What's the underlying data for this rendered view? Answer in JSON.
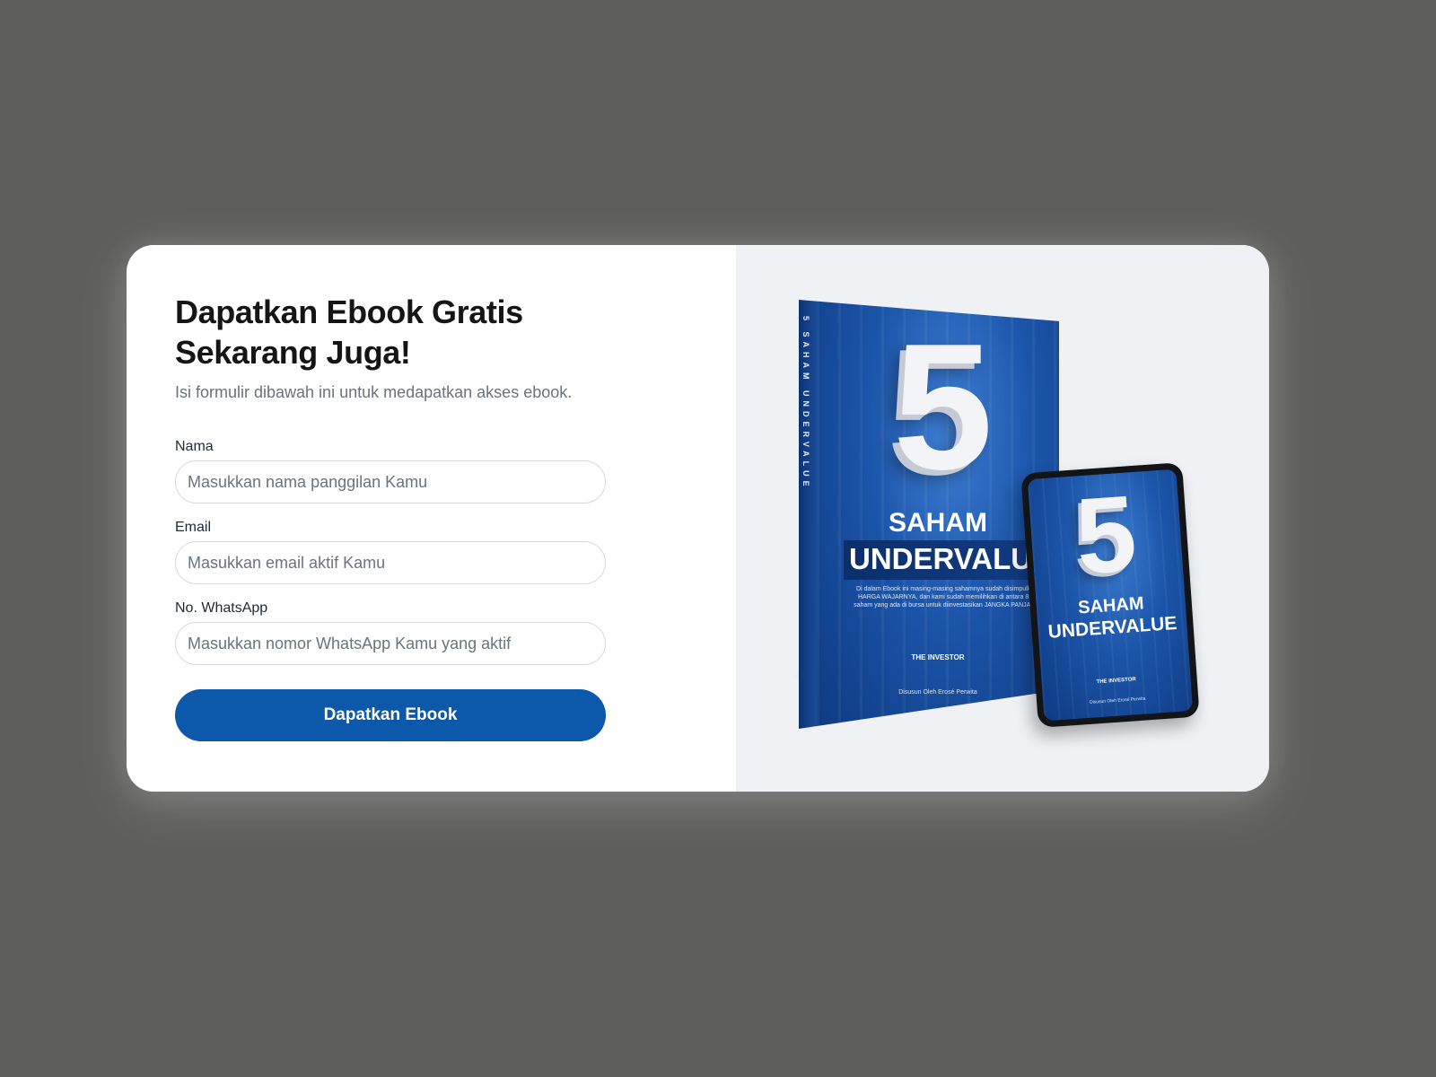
{
  "form": {
    "title_line1": "Dapatkan Ebook Gratis",
    "title_line2": "Sekarang Juga!",
    "subtitle": "Isi formulir dibawah ini untuk medapatkan akses ebook.",
    "fields": [
      {
        "label": "Nama",
        "placeholder": "Masukkan nama panggilan Kamu",
        "value": ""
      },
      {
        "label": "Email",
        "placeholder": "Masukkan email aktif Kamu",
        "value": ""
      },
      {
        "label": "No. WhatsApp",
        "placeholder": "Masukkan nomor WhatsApp Kamu yang aktif",
        "value": ""
      }
    ],
    "submit_label": "Dapatkan Ebook"
  },
  "colors": {
    "primary_button": "#0c58ab",
    "page_background": "#5e5e5d",
    "visual_panel_background": "#eff1f4"
  },
  "ebook": {
    "number": "5",
    "title_line1": "SAHAM",
    "title_line2": "UNDERVALUE",
    "spine_text": "5 SAHAM UNDERVALUE",
    "description": "Di dalam Ebook ini masing-masing sahamnya sudah disimpulkan HARGA WAJARNYA, dan kami sudah memilihkan di antara 810 saham yang ada di bursa untuk diinvestasikan JANGKA PANJANG",
    "logo_text": "THE INVESTOR",
    "author": "Disusun Oleh Erosé Perwita"
  }
}
